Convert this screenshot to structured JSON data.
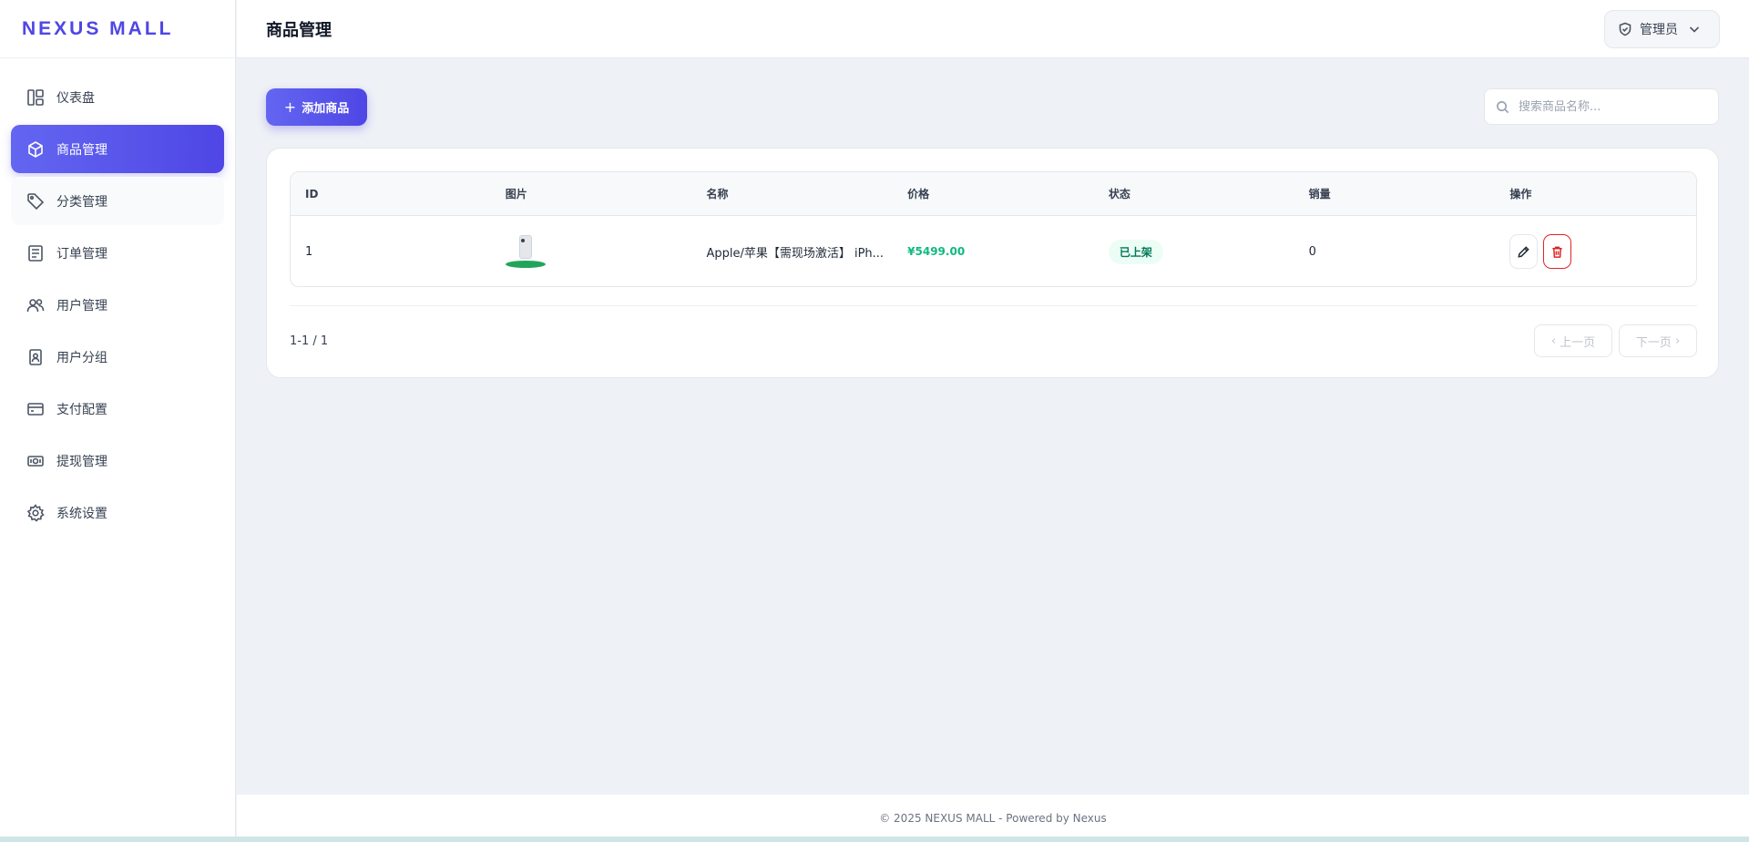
{
  "brand": {
    "name": "NEXUS MALL"
  },
  "sidebar": {
    "items": [
      {
        "label": "仪表盘",
        "icon": "dashboard-icon"
      },
      {
        "label": "商品管理",
        "icon": "box-icon",
        "active": true
      },
      {
        "label": "分类管理",
        "icon": "tag-icon"
      },
      {
        "label": "订单管理",
        "icon": "order-list-icon"
      },
      {
        "label": "用户管理",
        "icon": "users-icon"
      },
      {
        "label": "用户分组",
        "icon": "user-badge-icon"
      },
      {
        "label": "支付配置",
        "icon": "credit-card-icon"
      },
      {
        "label": "提现管理",
        "icon": "cash-icon"
      },
      {
        "label": "系统设置",
        "icon": "gear-icon"
      }
    ]
  },
  "header": {
    "title": "商品管理",
    "user_label": "管理员"
  },
  "toolbar": {
    "add_label": "添加商品",
    "search_placeholder": "搜索商品名称..."
  },
  "table": {
    "headers": [
      "ID",
      "图片",
      "名称",
      "价格",
      "状态",
      "销量",
      "操作"
    ],
    "rows": [
      {
        "id": "1",
        "name": "Apple/苹果【需现场激活】 iPh...",
        "price": "¥5499.00",
        "status": "已上架",
        "sales": "0"
      }
    ]
  },
  "pagination": {
    "info": "1-1 / 1",
    "prev_label": "上一页",
    "next_label": "下一页"
  },
  "footer": {
    "text": "© 2025 NEXUS MALL - Powered by Nexus"
  },
  "colors": {
    "accent": "#4f46e5",
    "price": "#10b981",
    "status_bg": "#ecfdf5",
    "danger": "#dc2626"
  }
}
